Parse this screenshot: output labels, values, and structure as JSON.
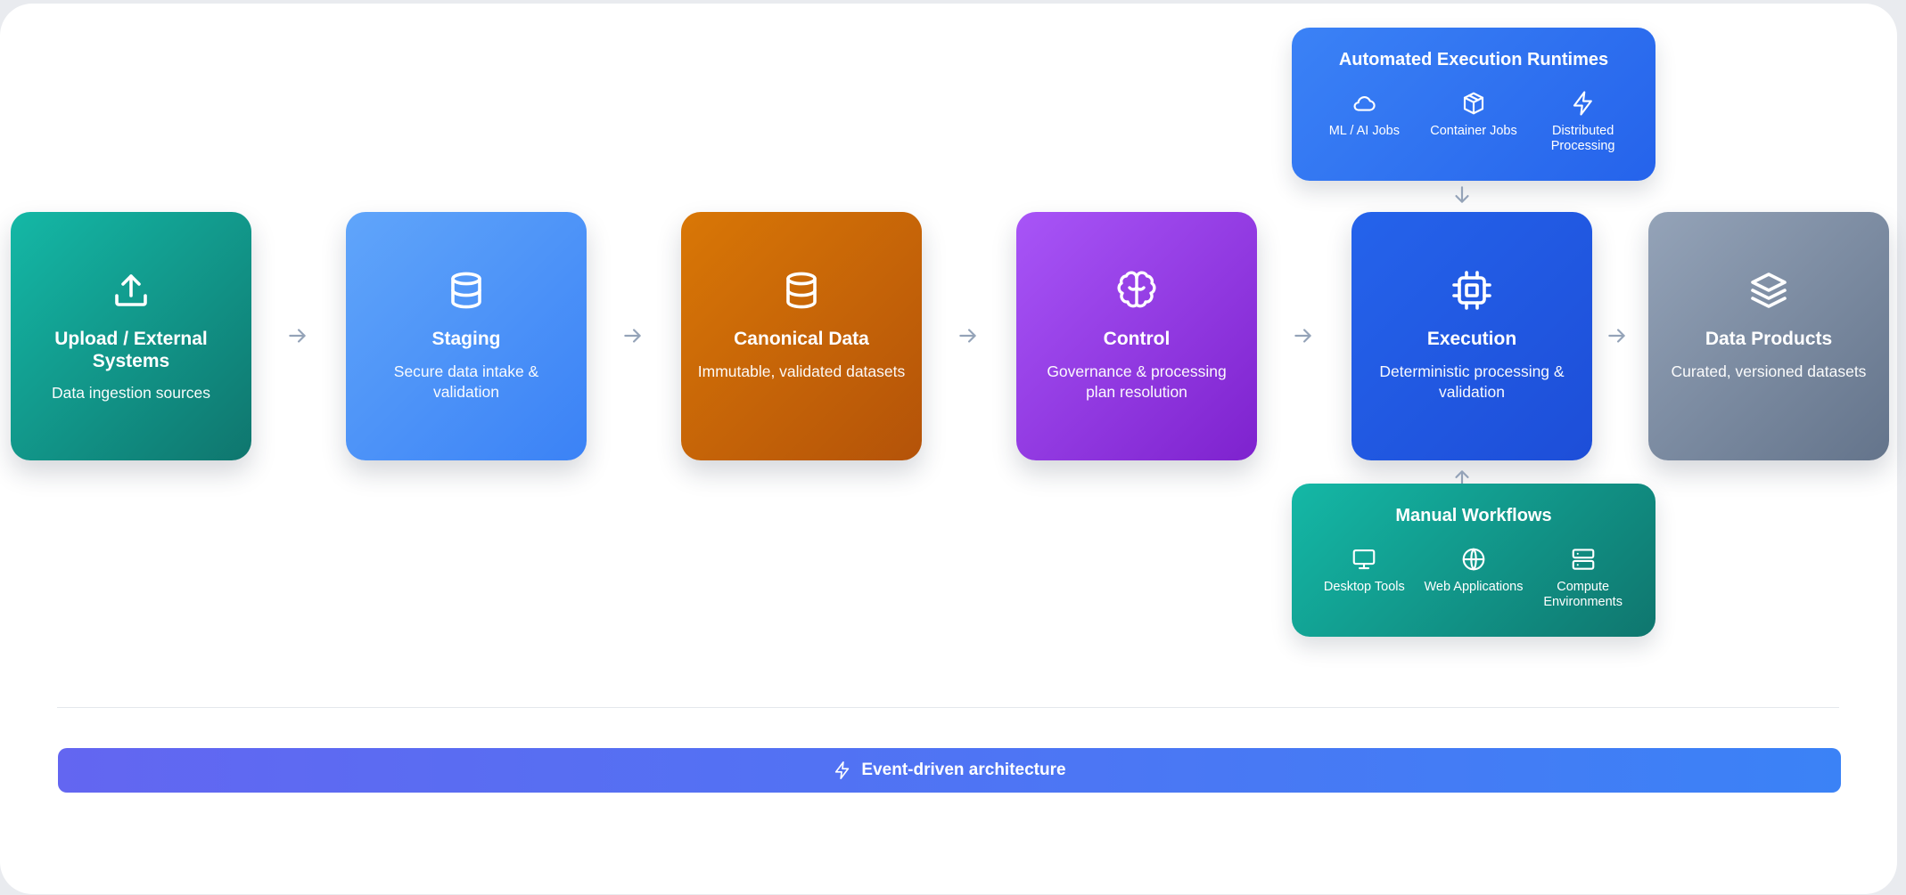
{
  "stages": [
    {
      "title": "Upload / External Systems",
      "description": "Data ingestion sources",
      "icon": "upload-icon"
    },
    {
      "title": "Staging",
      "description": "Secure data intake & validation",
      "icon": "database-icon"
    },
    {
      "title": "Canonical Data",
      "description": "Immutable, validated datasets",
      "icon": "database-icon"
    },
    {
      "title": "Control",
      "description": "Governance & processing plan resolution",
      "icon": "brain-icon"
    },
    {
      "title": "Execution",
      "description": "Deterministic processing & validation",
      "icon": "cpu-chip-icon"
    },
    {
      "title": "Data Products",
      "description": "Curated, versioned datasets",
      "icon": "layers-icon"
    }
  ],
  "automated": {
    "title": "Automated Execution Runtimes",
    "items": [
      {
        "label": "ML / AI Jobs",
        "icon": "cloud-icon"
      },
      {
        "label": "Container Jobs",
        "icon": "package-icon"
      },
      {
        "label": "Distributed Processing",
        "icon": "lightning-icon"
      }
    ]
  },
  "manual": {
    "title": "Manual Workflows",
    "items": [
      {
        "label": "Desktop Tools",
        "icon": "monitor-icon"
      },
      {
        "label": "Web Applications",
        "icon": "globe-icon"
      },
      {
        "label": "Compute Environments",
        "icon": "server-icon"
      }
    ]
  },
  "footer": {
    "label": "Event-driven architecture",
    "icon": "lightning-icon"
  },
  "colors": {
    "upload": "#14b8a6",
    "staging": "#60a5fa",
    "canonical": "#d97706",
    "control": "#a855f7",
    "execution": "#2563eb",
    "products": "#94a3b8",
    "arrow": "#94a3b8"
  }
}
